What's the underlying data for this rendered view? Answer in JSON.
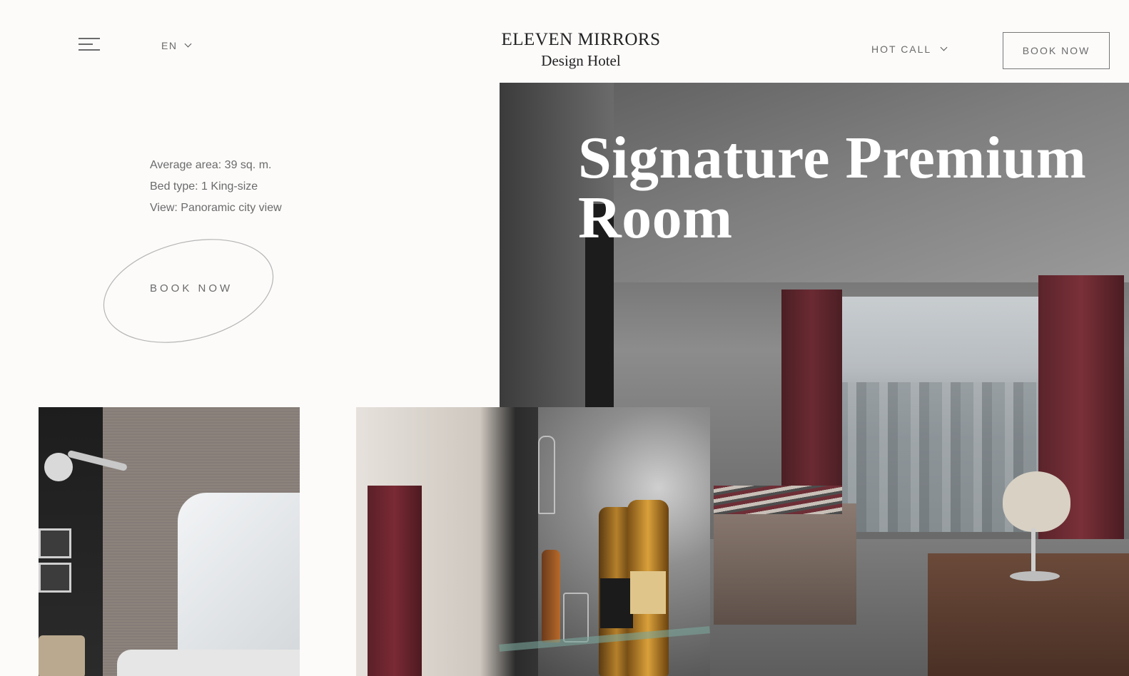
{
  "header": {
    "menu_icon": "hamburger-icon",
    "language": "EN",
    "logo_line1": "ELEVEN MIRRORS",
    "logo_line2": "Design Hotel",
    "hot_call": "HOT CALL",
    "book_now": "BOOK NOW"
  },
  "room": {
    "title_line1": "Signature Premium",
    "title_line2": "Room",
    "details": [
      "Average area: 39 sq. m.",
      "Bed type: 1 King-size",
      "View: Panoramic city view"
    ],
    "book_now": "BOOK NOW"
  },
  "colors": {
    "background": "#fcfbfa",
    "text": "#6b6b6b",
    "logo": "#222222",
    "title": "#ffffff"
  }
}
